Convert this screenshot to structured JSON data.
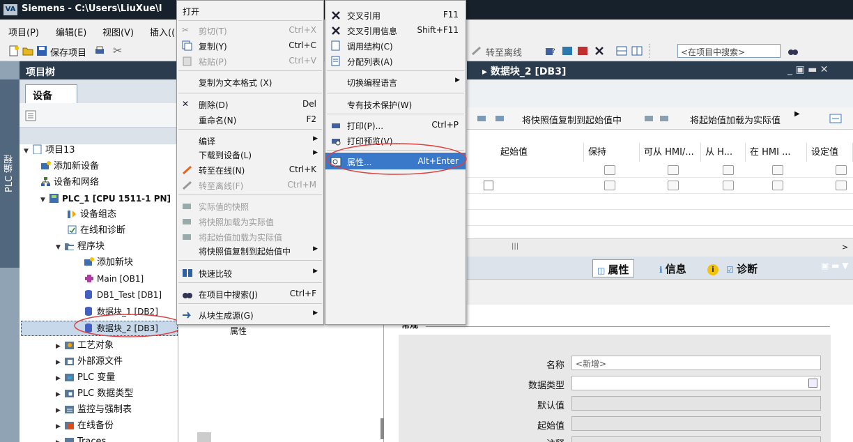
{
  "window": {
    "title": "Siemens  -  C:\\Users\\LiuXue\\I",
    "app_icon_label": "VA"
  },
  "menubar": {
    "items": [
      "项目(P)",
      "编辑(E)",
      "视图(V)",
      "插入(("
    ]
  },
  "toolbar": {
    "save_label": "保存项目",
    "go_offline_label": "转至离线",
    "search_placeholder": "<在项目中搜索>"
  },
  "sidebar_strip": {
    "label": "PLC 编程"
  },
  "project_tree": {
    "header": "项目树",
    "tab": "设备",
    "items": [
      {
        "label": "项目13"
      },
      {
        "label": "添加新设备"
      },
      {
        "label": "设备和网络"
      },
      {
        "label": "PLC_1 [CPU 1511-1 PN]"
      },
      {
        "label": "设备组态"
      },
      {
        "label": "在线和诊断"
      },
      {
        "label": "程序块"
      },
      {
        "label": "添加新块"
      },
      {
        "label": "Main [OB1]"
      },
      {
        "label": "DB1_Test [DB1]"
      },
      {
        "label": "数据块_1 [DB2]"
      },
      {
        "label": "数据块_2 [DB3]"
      },
      {
        "label": "工艺对象"
      },
      {
        "label": "外部源文件"
      },
      {
        "label": "PLC 变量"
      },
      {
        "label": "PLC 数据类型"
      },
      {
        "label": "监控与强制表"
      },
      {
        "label": "在线备份"
      },
      {
        "label": "Traces"
      }
    ]
  },
  "middle": {
    "property_label": "属性"
  },
  "editor": {
    "breadcrumb": "▸ 数据块_2 [DB3]",
    "toolbar": {
      "copy_snapshot": "将快照值复制到起始值中",
      "load_start": "将起始值加载为实际值"
    },
    "columns": [
      "起始值",
      "保持",
      "可从 HMI/...",
      "从 H...",
      "在 HMI ...",
      "设定值"
    ]
  },
  "inspector": {
    "tabs": [
      "属性",
      "信息",
      "诊断"
    ],
    "section_header": "常规",
    "fields": [
      {
        "label": "名称",
        "value": "<新增>"
      },
      {
        "label": "数据类型",
        "value": ""
      },
      {
        "label": "默认值",
        "value": ""
      },
      {
        "label": "起始值",
        "value": ""
      },
      {
        "label": "注释",
        "value": ""
      }
    ]
  },
  "context_menu": {
    "items": [
      {
        "label": "打开",
        "shortcut": ""
      },
      {
        "label": "剪切(T)",
        "shortcut": "Ctrl+X"
      },
      {
        "label": "复制(Y)",
        "shortcut": "Ctrl+C"
      },
      {
        "label": "粘贴(P)",
        "shortcut": "Ctrl+V"
      },
      {
        "label": "复制为文本格式 (X)",
        "shortcut": ""
      },
      {
        "label": "删除(D)",
        "shortcut": "Del"
      },
      {
        "label": "重命名(N)",
        "shortcut": "F2"
      },
      {
        "label": "编译",
        "shortcut": ""
      },
      {
        "label": "下载到设备(L)",
        "shortcut": ""
      },
      {
        "label": "转至在线(N)",
        "shortcut": "Ctrl+K"
      },
      {
        "label": "转至离线(F)",
        "shortcut": "Ctrl+M"
      },
      {
        "label": "实际值的快照",
        "shortcut": ""
      },
      {
        "label": "将快照加载为实际值",
        "shortcut": ""
      },
      {
        "label": "将起始值加载为实际值",
        "shortcut": ""
      },
      {
        "label": "将快照值复制到起始值中",
        "shortcut": ""
      },
      {
        "label": "快速比较",
        "shortcut": ""
      },
      {
        "label": "在项目中搜索(J)",
        "shortcut": "Ctrl+F"
      },
      {
        "label": "从块生成源(G)",
        "shortcut": ""
      }
    ]
  },
  "submenu": {
    "items": [
      {
        "label": "交叉引用",
        "shortcut": "F11"
      },
      {
        "label": "交叉引用信息",
        "shortcut": "Shift+F11"
      },
      {
        "label": "调用结构(C)",
        "shortcut": ""
      },
      {
        "label": "分配列表(A)",
        "shortcut": ""
      },
      {
        "label": "切换编程语言",
        "shortcut": ""
      },
      {
        "label": "专有技术保护(W)",
        "shortcut": ""
      },
      {
        "label": "打印(P)...",
        "shortcut": "Ctrl+P"
      },
      {
        "label": "打印预览(V)...",
        "shortcut": ""
      },
      {
        "label": "属性...",
        "shortcut": "Alt+Enter"
      }
    ]
  },
  "colors": {
    "accent": "#3a78c9",
    "header": "#2a3c4e",
    "annotation": "#e04040"
  }
}
